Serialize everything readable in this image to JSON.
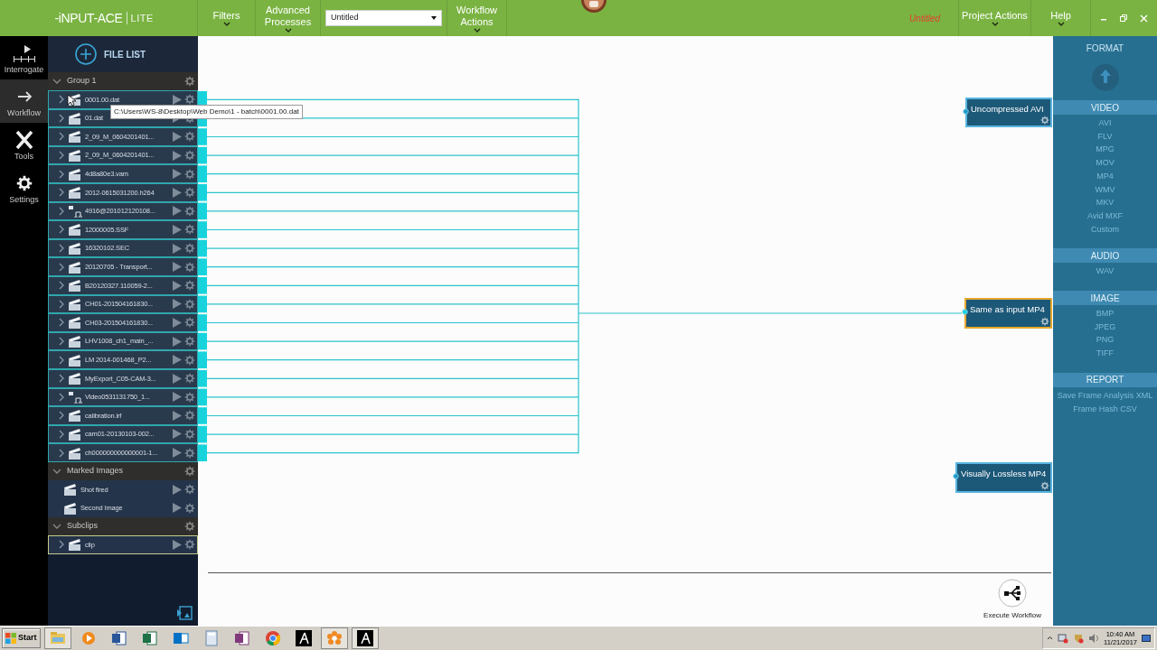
{
  "app": {
    "logo": "-iNPUT-ACE",
    "edition": "LITE",
    "project_name": "Untitled"
  },
  "menu": [
    {
      "kind": "menu",
      "label": "Filters"
    },
    {
      "kind": "menu",
      "label": "Advanced Processes"
    },
    {
      "kind": "dropdown",
      "value": "Untitled"
    },
    {
      "kind": "menu",
      "label": "Workflow Actions"
    }
  ],
  "right_menu": [
    {
      "label": "Project Actions"
    },
    {
      "label": "Help"
    }
  ],
  "nav": [
    {
      "label": "Interrogate",
      "kind": "interrogate",
      "selected": false
    },
    {
      "label": "Workflow",
      "kind": "workflow",
      "selected": true
    },
    {
      "label": "Tools",
      "kind": "tools",
      "selected": false
    },
    {
      "label": "Settings",
      "kind": "settings",
      "selected": false
    }
  ],
  "file_list": {
    "title": "FILE LIST",
    "groups": [
      {
        "name": "Group 1",
        "expanded": true,
        "items": [
          {
            "name": "0001.00.dat",
            "kind": "video",
            "selected": false
          },
          {
            "name": "01.dat",
            "kind": "video",
            "selected": false
          },
          {
            "name": "2_09_M_0604201401...",
            "kind": "video",
            "selected": false
          },
          {
            "name": "2_09_M_0604201401...",
            "kind": "video",
            "selected": false
          },
          {
            "name": "4d8a80e3.vam",
            "kind": "video",
            "selected": false
          },
          {
            "name": "2012-0615031200.h264",
            "kind": "video",
            "selected": false
          },
          {
            "name": "4916@201012120108...",
            "kind": "audio",
            "selected": false
          },
          {
            "name": "12000005.SSF",
            "kind": "video",
            "selected": false
          },
          {
            "name": "16320102.SEC",
            "kind": "video",
            "selected": false
          },
          {
            "name": "20120705 - Transport...",
            "kind": "video",
            "selected": false
          },
          {
            "name": "B20120327.110059-2...",
            "kind": "video",
            "selected": false
          },
          {
            "name": "CH01-201504161830...",
            "kind": "video",
            "selected": false
          },
          {
            "name": "CH03-201504161830...",
            "kind": "video",
            "selected": false
          },
          {
            "name": "LHV1008_ch1_main_...",
            "kind": "video",
            "selected": false
          },
          {
            "name": "LM 2014-001468_P2...",
            "kind": "video",
            "selected": false
          },
          {
            "name": "MyExport_C05-CAM-3...",
            "kind": "video",
            "selected": false
          },
          {
            "name": "Video0531131750_1...",
            "kind": "audio",
            "selected": false
          },
          {
            "name": "calibration.irf",
            "kind": "video",
            "selected": false
          },
          {
            "name": "cam01-20130103-002...",
            "kind": "video",
            "selected": false
          },
          {
            "name": "ch000000000000001-1...",
            "kind": "video",
            "selected": false
          }
        ]
      },
      {
        "name": "Marked Images",
        "expanded": true,
        "items": [
          {
            "name": "Shot fired",
            "kind": "image",
            "selected": false
          },
          {
            "name": "Second Image",
            "kind": "image",
            "selected": false
          }
        ]
      },
      {
        "name": "Subclips",
        "expanded": true,
        "items": [
          {
            "name": "clip",
            "kind": "video",
            "selected": true
          }
        ]
      }
    ]
  },
  "tooltip": "C:\\Users\\WS-8\\Desktop\\Web Demo\\1 - batch\\0001.00.dat",
  "workflow_nodes": [
    {
      "label": "Uncompressed AVI",
      "selected": false,
      "connected": false
    },
    {
      "label": "Same as input MP4",
      "selected": true,
      "connected": true
    },
    {
      "label": "Visually Lossless MP4",
      "selected": false,
      "connected": false
    }
  ],
  "execute_button": "Execute Workflow",
  "format_panel": {
    "title": "FORMAT",
    "sections": [
      {
        "title": "VIDEO",
        "items": [
          {
            "label": "AVI",
            "disabled": true
          },
          {
            "label": "FLV",
            "disabled": true
          },
          {
            "label": "MPG",
            "disabled": true
          },
          {
            "label": "MOV",
            "disabled": true
          },
          {
            "label": "MP4",
            "disabled": true
          },
          {
            "label": "WMV",
            "disabled": true
          },
          {
            "label": "MKV",
            "disabled": true
          },
          {
            "label": "Avid MXF",
            "disabled": true
          },
          {
            "label": "Custom",
            "disabled": true
          }
        ]
      },
      {
        "title": "AUDIO",
        "items": [
          {
            "label": "WAV",
            "disabled": true
          }
        ]
      },
      {
        "title": "IMAGE",
        "items": [
          {
            "label": "BMP",
            "disabled": true
          },
          {
            "label": "JPEG",
            "disabled": true
          },
          {
            "label": "PNG",
            "disabled": true
          },
          {
            "label": "TIFF",
            "disabled": true
          }
        ]
      },
      {
        "title": "REPORT",
        "items": [
          {
            "label": "Save Frame Analysis XML",
            "disabled": true
          },
          {
            "label": "Frame Hash CSV",
            "disabled": true
          }
        ]
      }
    ]
  },
  "taskbar": {
    "start": "Start",
    "apps": [
      {
        "kind": "folder",
        "pressed": true
      },
      {
        "kind": "media",
        "pressed": false
      },
      {
        "kind": "word",
        "pressed": false
      },
      {
        "kind": "excel",
        "pressed": false
      },
      {
        "kind": "outlook",
        "pressed": false
      },
      {
        "kind": "calculator",
        "pressed": false
      },
      {
        "kind": "onenote",
        "pressed": false
      },
      {
        "kind": "chrome",
        "pressed": false
      },
      {
        "kind": "a-app",
        "pressed": false
      },
      {
        "kind": "flower",
        "pressed": true
      },
      {
        "kind": "a-app",
        "pressed": true
      }
    ],
    "time": "10:40 AM",
    "date": "11/21/2017"
  }
}
